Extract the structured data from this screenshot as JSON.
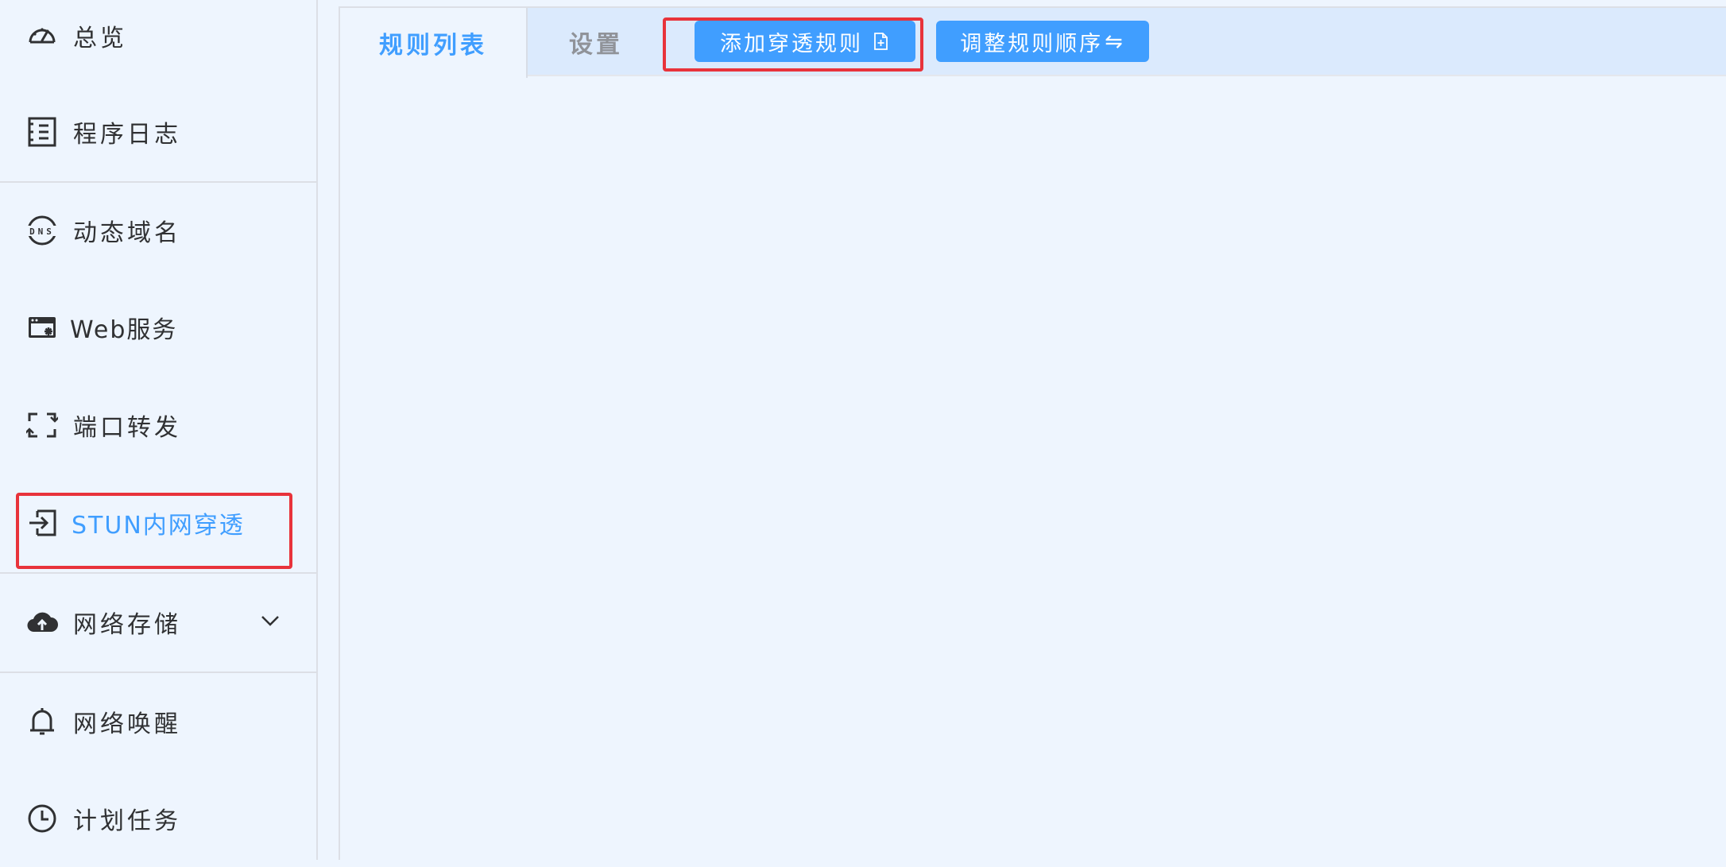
{
  "sidebar": {
    "items": [
      {
        "label": "总览",
        "icon": "dashboard-icon"
      },
      {
        "label": "程序日志",
        "icon": "log-icon"
      },
      {
        "label": "动态域名",
        "icon": "dns-icon"
      },
      {
        "label": "Web服务",
        "icon": "web-service-icon"
      },
      {
        "label": "端口转发",
        "icon": "port-forward-icon"
      },
      {
        "label": "STUN内网穿透",
        "icon": "stun-icon",
        "active": true
      },
      {
        "label": "网络存储",
        "icon": "cloud-upload-icon"
      },
      {
        "label": "网络唤醒",
        "icon": "bell-icon"
      },
      {
        "label": "计划任务",
        "icon": "clock-icon"
      }
    ],
    "dns_text": "DNS"
  },
  "tabs": [
    {
      "label": "规则列表",
      "active": true
    },
    {
      "label": "设置",
      "active": false
    }
  ],
  "toolbar": {
    "add_label": "添加穿透规则",
    "order_label": "调整规则顺序",
    "order_symbol": "⇋"
  },
  "colors": {
    "accent": "#409eff",
    "highlight": "#e8333b",
    "background": "#eef5fe",
    "tabbar": "#dbeafd"
  }
}
